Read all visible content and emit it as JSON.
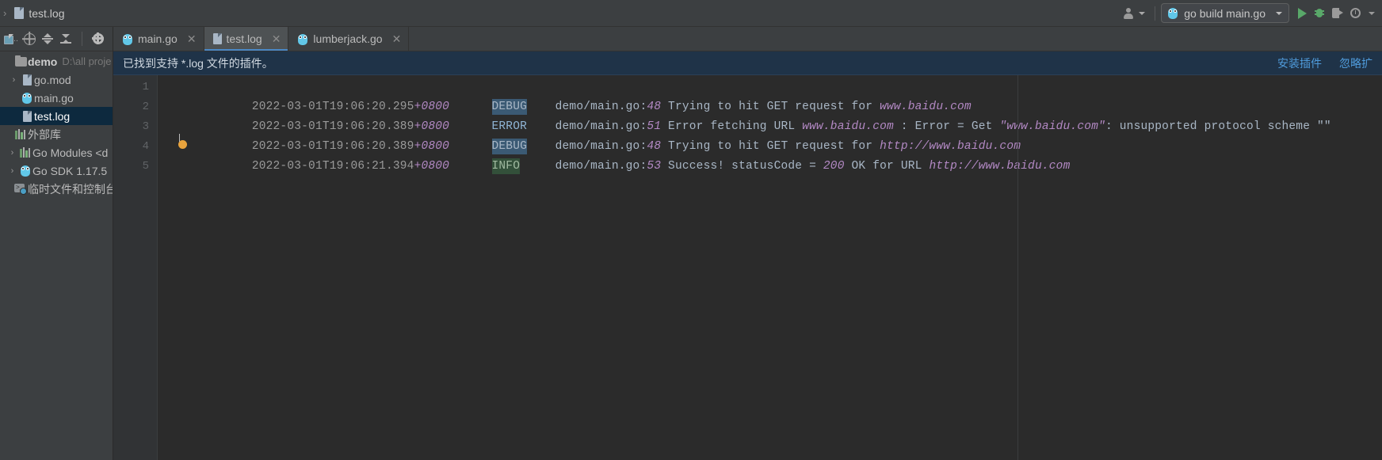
{
  "window": {
    "breadcrumb": {
      "file": "test.log",
      "separator": "›"
    }
  },
  "toolbar": {
    "avatar_label": "",
    "run_config": "go build main.go",
    "buttons": [
      "run",
      "debug",
      "run-with-coverage",
      "profile"
    ]
  },
  "sidebar": {
    "toolbar_icons": [
      "select-opened-file-icon",
      "locate-icon",
      "expand-all-icon",
      "collapse-all-icon",
      "settings-gear-icon"
    ],
    "tree": [
      {
        "label": "demo",
        "sub": "D:\\all proje",
        "icon": "folder-icon",
        "arrow": "",
        "bold": true,
        "selected": false,
        "indent": 0
      },
      {
        "label": "go.mod",
        "sub": "",
        "icon": "file-icon",
        "arrow": "›",
        "bold": false,
        "selected": false,
        "indent": 1
      },
      {
        "label": "main.go",
        "sub": "",
        "icon": "gopher-icon",
        "arrow": "",
        "bold": false,
        "selected": false,
        "indent": 1
      },
      {
        "label": "test.log",
        "sub": "",
        "icon": "file-icon",
        "arrow": "",
        "bold": false,
        "selected": true,
        "indent": 1
      },
      {
        "label": "外部库",
        "sub": "",
        "icon": "libraries-icon",
        "arrow": "",
        "bold": false,
        "selected": false,
        "indent": 0
      },
      {
        "label": "Go Modules <d",
        "sub": "",
        "icon": "libraries-icon",
        "arrow": "›",
        "bold": false,
        "selected": false,
        "indent": 1
      },
      {
        "label": "Go SDK 1.17.5",
        "sub": "",
        "icon": "gopher-icon",
        "arrow": "›",
        "bold": false,
        "selected": false,
        "indent": 1
      },
      {
        "label": "临时文件和控制台",
        "sub": "",
        "icon": "scratches-icon",
        "arrow": "",
        "bold": false,
        "selected": false,
        "indent": 0
      }
    ]
  },
  "tabs": [
    {
      "label": "main.go",
      "icon": "gopher-icon",
      "active": false,
      "closable": true
    },
    {
      "label": "test.log",
      "icon": "file-icon",
      "active": true,
      "closable": true
    },
    {
      "label": "lumberjack.go",
      "icon": "gopher-icon",
      "active": false,
      "closable": true
    }
  ],
  "notification": {
    "message": "已找到支持 *.log 文件的插件。",
    "install_link": "安装插件",
    "ignore_link": "忽略扩"
  },
  "editor": {
    "line_numbers": [
      "1",
      "2",
      "3",
      "4",
      "5"
    ],
    "lines": [
      {
        "n": "1",
        "timestamp": "2022-03-01T19:06:20.295",
        "tz": "+0800",
        "level": "DEBUG",
        "level_style": "debug",
        "source": "demo/main.go:",
        "source_line": "48",
        "message": " Trying to hit GET request for ",
        "url": "www.baidu.com",
        "tail": ""
      },
      {
        "n": "2",
        "timestamp": "2022-03-01T19:06:20.389",
        "tz": "+0800",
        "level": "ERROR",
        "level_style": "error",
        "source": "demo/main.go:",
        "source_line": "51",
        "message": " Error fetching URL ",
        "url": "www.baidu.com",
        "tail": " : Error = Get ",
        "quoted": "\"www.baidu.com\"",
        "tail2": ": unsupported protocol scheme \"\""
      },
      {
        "n": "3",
        "timestamp": "2022-03-01T19:06:20.389",
        "tz": "+0800",
        "level": "DEBUG",
        "level_style": "debug",
        "source": "demo/main.go:",
        "source_line": "48",
        "message": " Trying to hit GET request for ",
        "url": "http://www.baidu.com",
        "tail": ""
      },
      {
        "n": "4",
        "timestamp": "2022-03-01T19:06:21.394",
        "tz": "+0800",
        "level": "INFO",
        "level_style": "info",
        "source": "demo/main.go:",
        "source_line": "53",
        "message": " Success! statusCode = ",
        "status_code": "200",
        "tail": " OK for URL ",
        "url": "http://www.baidu.com",
        "tail2": ""
      },
      {
        "n": "5",
        "timestamp": "",
        "tz": "",
        "level": "",
        "level_style": "",
        "source": "",
        "source_line": "",
        "message": "",
        "url": "",
        "tail": ""
      }
    ]
  },
  "colors": {
    "bg_editor": "#2b2b2b",
    "bg_panel": "#3c3f41",
    "accent_blue": "#4a88c7",
    "debug_bg": "#3b5a74",
    "info_bg": "#33503a",
    "purple": "#b389c4",
    "selection": "#0d293e",
    "notify_bg": "#1f3348",
    "link": "#4f9bdb"
  }
}
